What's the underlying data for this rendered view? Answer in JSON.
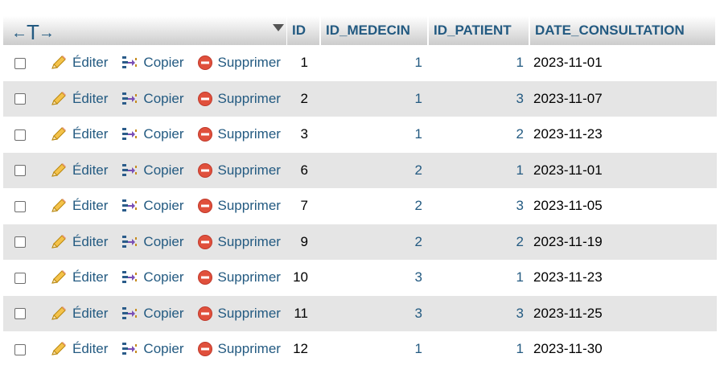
{
  "header": {
    "arrow_left": "←",
    "arrow_tee": "T",
    "arrow_right": "→",
    "columns": [
      "ID",
      "ID_MEDECIN",
      "ID_PATIENT",
      "DATE_CONSULTATION"
    ]
  },
  "actions": {
    "edit_label": "Éditer",
    "copy_label": "Copier",
    "delete_label": "Supprimer"
  },
  "rows": [
    {
      "id": "1",
      "id_medecin": "1",
      "id_patient": "1",
      "date_consultation": "2023-11-01"
    },
    {
      "id": "2",
      "id_medecin": "1",
      "id_patient": "3",
      "date_consultation": "2023-11-07"
    },
    {
      "id": "3",
      "id_medecin": "1",
      "id_patient": "2",
      "date_consultation": "2023-11-23"
    },
    {
      "id": "6",
      "id_medecin": "2",
      "id_patient": "1",
      "date_consultation": "2023-11-01"
    },
    {
      "id": "7",
      "id_medecin": "2",
      "id_patient": "3",
      "date_consultation": "2023-11-05"
    },
    {
      "id": "9",
      "id_medecin": "2",
      "id_patient": "2",
      "date_consultation": "2023-11-19"
    },
    {
      "id": "10",
      "id_medecin": "3",
      "id_patient": "1",
      "date_consultation": "2023-11-23"
    },
    {
      "id": "11",
      "id_medecin": "3",
      "id_patient": "3",
      "date_consultation": "2023-11-25"
    },
    {
      "id": "12",
      "id_medecin": "1",
      "id_patient": "1",
      "date_consultation": "2023-11-30"
    }
  ],
  "icons": {
    "edit": "pencil-icon",
    "copy": "copy-icon",
    "delete": "delete-icon",
    "sort": "sort-caret-icon"
  },
  "colors": {
    "link": "#235a81",
    "row_alt": "#e5e5e5",
    "delete_red": "#e0503c"
  }
}
